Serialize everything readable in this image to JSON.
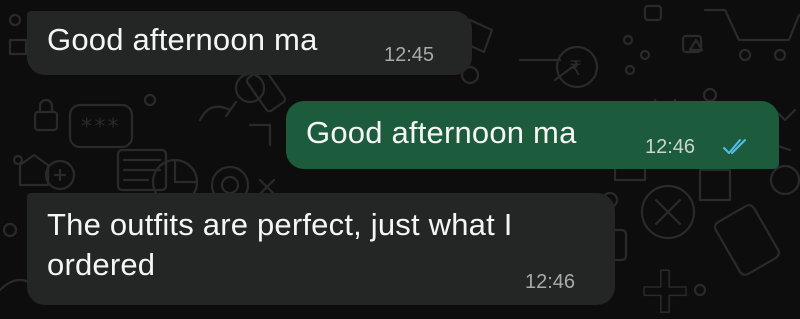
{
  "colors": {
    "background": "#0d0d0d",
    "incoming_bubble": "#242626",
    "outgoing_bubble": "#1c5c3c",
    "read_ticks": "#53bdeb"
  },
  "messages": [
    {
      "direction": "incoming",
      "text": "Good afternoon ma",
      "time": "12:45"
    },
    {
      "direction": "outgoing",
      "text": "Good afternoon ma",
      "time": "12:46",
      "status": "read-double-tick-icon"
    },
    {
      "direction": "incoming",
      "text": "The outfits are perfect, just what I\nordered",
      "time": "12:46"
    }
  ]
}
